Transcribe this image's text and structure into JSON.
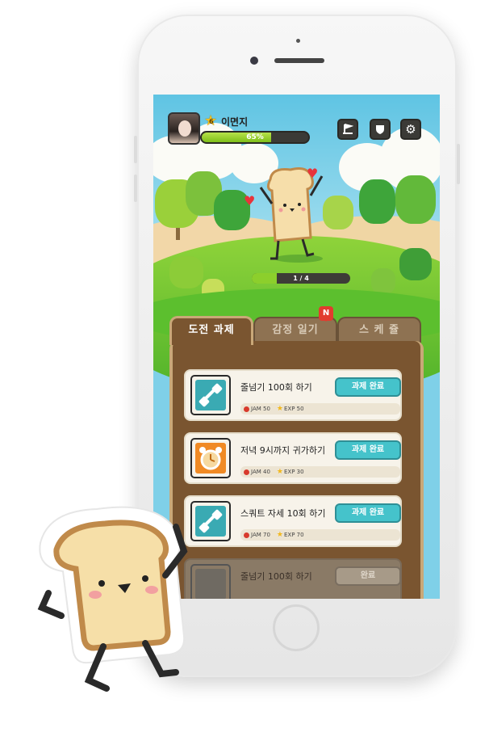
{
  "player": {
    "name": "이면지",
    "level": "6",
    "xp_percent_label": "65%",
    "xp_fraction": 0.65
  },
  "hud_icons": [
    "flag-icon",
    "shield-icon",
    "gear-icon"
  ],
  "stage_progress": {
    "label": "1 / 4",
    "fraction": 0.25
  },
  "tabs": [
    {
      "label": "도전 과제",
      "active": true
    },
    {
      "label": "감정 일기",
      "active": false
    },
    {
      "label": "스 케 쥴",
      "active": false
    }
  ],
  "notification_badge": "N",
  "missions": [
    {
      "title": "줄넘기 100회 하기",
      "button": "과제 완료",
      "jam": "JAM 50",
      "exp": "EXP 50",
      "icon": "dumbbell-icon",
      "icon_color": "#3aaab3"
    },
    {
      "title": "저녁 9시까지 귀가하기",
      "button": "과제 완료",
      "jam": "JAM 40",
      "exp": "EXP 30",
      "icon": "alarm-clock-icon",
      "icon_color": "#f08a24"
    },
    {
      "title": "스쿼트 자세  10회 하기",
      "button": "과제 완료",
      "jam": "JAM 70",
      "exp": "EXP 70",
      "icon": "dumbbell-icon",
      "icon_color": "#3aaab3"
    },
    {
      "title": "줄넘기 100회 하기",
      "button": "완료",
      "jam": "",
      "exp": "",
      "icon": "dumbbell-icon",
      "icon_color": "#888888"
    }
  ],
  "colors": {
    "accent": "#45c3cb",
    "panel": "#7a5530",
    "xp_fill": "#8ccf2c",
    "jam": "#d83a2c"
  }
}
